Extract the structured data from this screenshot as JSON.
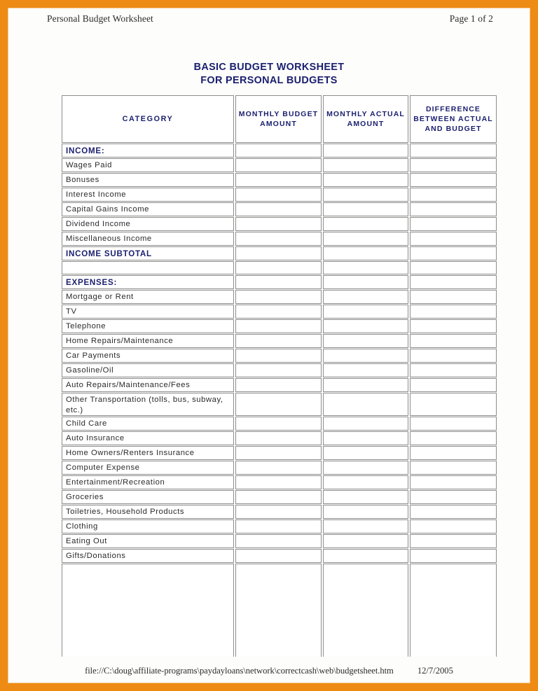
{
  "page": {
    "header_left": "Personal Budget Worksheet",
    "header_right": "Page 1 of 2",
    "title_line1": "BASIC BUDGET WORKSHEET",
    "title_line2": "FOR PERSONAL BUDGETS",
    "footer_path": "file://C:\\doug\\affiliate-programs\\paydayloans\\network\\correctcash\\web\\budgetsheet.htm",
    "footer_date": "12/7/2005",
    "border_color": "#ED8B15",
    "heading_color": "#1a1f6e",
    "text_color": "#2a2a2a"
  },
  "table": {
    "columns": [
      {
        "label": "CATEGORY",
        "key": "category"
      },
      {
        "label": "MONTHLY BUDGET AMOUNT",
        "key": "monthly_budget_amount"
      },
      {
        "label": "MONTHLY ACTUAL AMOUNT",
        "key": "monthly_actual_amount"
      },
      {
        "label": "DIFFERENCE BETWEEN ACTUAL AND BUDGET",
        "key": "difference_between_actual_and_budget"
      }
    ],
    "rows": [
      {
        "label": "INCOME:",
        "type": "section",
        "budget": "",
        "actual": "",
        "difference": ""
      },
      {
        "label": "Wages Paid",
        "type": "item",
        "budget": "",
        "actual": "",
        "difference": ""
      },
      {
        "label": "Bonuses",
        "type": "item",
        "budget": "",
        "actual": "",
        "difference": ""
      },
      {
        "label": "Interest Income",
        "type": "item",
        "budget": "",
        "actual": "",
        "difference": ""
      },
      {
        "label": "Capital Gains Income",
        "type": "item",
        "budget": "",
        "actual": "",
        "difference": ""
      },
      {
        "label": "Dividend Income",
        "type": "item",
        "budget": "",
        "actual": "",
        "difference": ""
      },
      {
        "label": "Miscellaneous Income",
        "type": "item",
        "budget": "",
        "actual": "",
        "difference": ""
      },
      {
        "label": "INCOME SUBTOTAL",
        "type": "section",
        "budget": "",
        "actual": "",
        "difference": ""
      },
      {
        "label": "",
        "type": "spacer",
        "budget": "",
        "actual": "",
        "difference": ""
      },
      {
        "label": "EXPENSES:",
        "type": "section",
        "budget": "",
        "actual": "",
        "difference": ""
      },
      {
        "label": "Mortgage or Rent",
        "type": "item",
        "budget": "",
        "actual": "",
        "difference": ""
      },
      {
        "label": "TV",
        "type": "item",
        "budget": "",
        "actual": "",
        "difference": ""
      },
      {
        "label": "Telephone",
        "type": "item",
        "budget": "",
        "actual": "",
        "difference": ""
      },
      {
        "label": "Home Repairs/Maintenance",
        "type": "item",
        "budget": "",
        "actual": "",
        "difference": ""
      },
      {
        "label": "Car Payments",
        "type": "item",
        "budget": "",
        "actual": "",
        "difference": ""
      },
      {
        "label": "Gasoline/Oil",
        "type": "item",
        "budget": "",
        "actual": "",
        "difference": ""
      },
      {
        "label": "Auto Repairs/Maintenance/Fees",
        "type": "item",
        "budget": "",
        "actual": "",
        "difference": ""
      },
      {
        "label": "Other Transportation (tolls, bus, subway, etc.)",
        "type": "item-2line",
        "budget": "",
        "actual": "",
        "difference": ""
      },
      {
        "label": "Child Care",
        "type": "item",
        "budget": "",
        "actual": "",
        "difference": ""
      },
      {
        "label": "Auto Insurance",
        "type": "item",
        "budget": "",
        "actual": "",
        "difference": ""
      },
      {
        "label": "Home Owners/Renters Insurance",
        "type": "item",
        "budget": "",
        "actual": "",
        "difference": ""
      },
      {
        "label": "Computer Expense",
        "type": "item",
        "budget": "",
        "actual": "",
        "difference": ""
      },
      {
        "label": "Entertainment/Recreation",
        "type": "item",
        "budget": "",
        "actual": "",
        "difference": ""
      },
      {
        "label": "Groceries",
        "type": "item",
        "budget": "",
        "actual": "",
        "difference": ""
      },
      {
        "label": "Toiletries, Household Products",
        "type": "item",
        "budget": "",
        "actual": "",
        "difference": ""
      },
      {
        "label": "Clothing",
        "type": "item",
        "budget": "",
        "actual": "",
        "difference": ""
      },
      {
        "label": "Eating Out",
        "type": "item",
        "budget": "",
        "actual": "",
        "difference": ""
      },
      {
        "label": "Gifts/Donations",
        "type": "item",
        "budget": "",
        "actual": "",
        "difference": ""
      },
      {
        "label": "",
        "type": "tail",
        "budget": "",
        "actual": "",
        "difference": ""
      }
    ]
  }
}
